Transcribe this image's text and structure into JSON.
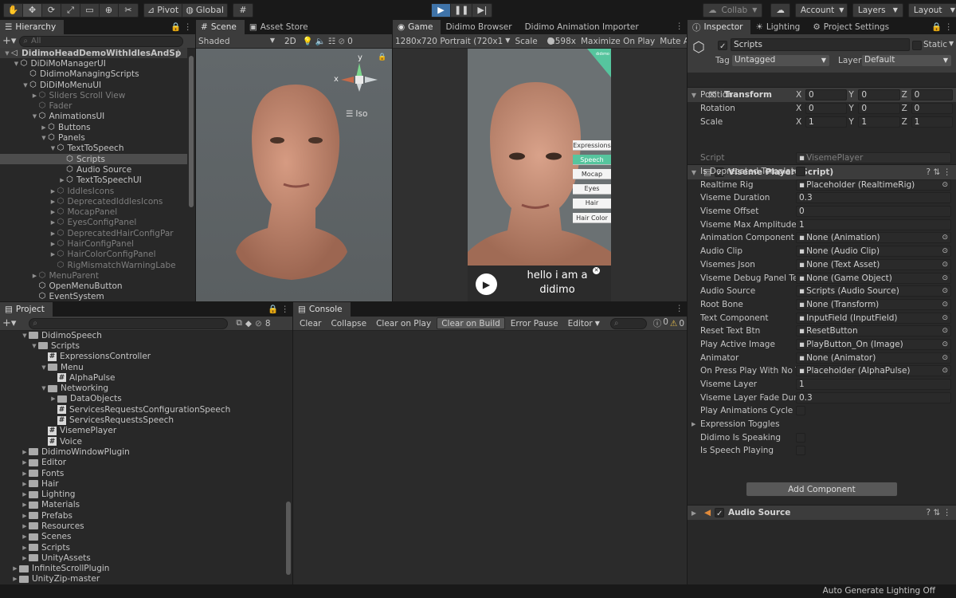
{
  "toolbar": {
    "tools": [
      "hand-icon",
      "move-icon",
      "rotate-icon",
      "scale-icon",
      "rect-icon",
      "transform-icon",
      "custom-tool-icon"
    ],
    "pivot": "Pivot",
    "global": "Global",
    "collab": "Collab",
    "account": "Account",
    "layers": "Layers",
    "layout": "Layout"
  },
  "hierarchy": {
    "tab": "Hierarchy",
    "search_placeholder": "All",
    "items": [
      {
        "label": "DidimoHeadDemoWithIdlesAndSp",
        "depth": 0,
        "state": "open",
        "icon": "scene",
        "dim": false,
        "sel": false,
        "bold": true
      },
      {
        "label": "DiDiMoManagerUI",
        "depth": 1,
        "state": "open",
        "icon": "cube",
        "dim": false,
        "sel": false
      },
      {
        "label": "DidimoManagingScripts",
        "depth": 2,
        "state": "none",
        "icon": "cube",
        "dim": false,
        "sel": false
      },
      {
        "label": "DiDiMoMenuUI",
        "depth": 2,
        "state": "open",
        "icon": "cube",
        "dim": false,
        "sel": false
      },
      {
        "label": "Sliders Scroll View",
        "depth": 3,
        "state": "closed",
        "icon": "cube",
        "dim": true,
        "sel": false
      },
      {
        "label": "Fader",
        "depth": 3,
        "state": "none",
        "icon": "cube",
        "dim": true,
        "sel": false
      },
      {
        "label": "AnimationsUI",
        "depth": 3,
        "state": "open",
        "icon": "cube",
        "dim": false,
        "sel": false
      },
      {
        "label": "Buttons",
        "depth": 4,
        "state": "closed",
        "icon": "cube",
        "dim": false,
        "sel": false
      },
      {
        "label": "Panels",
        "depth": 4,
        "state": "open",
        "icon": "cube",
        "dim": false,
        "sel": false
      },
      {
        "label": "TextToSpeech",
        "depth": 5,
        "state": "open",
        "icon": "cube",
        "dim": false,
        "sel": false
      },
      {
        "label": "Scripts",
        "depth": 6,
        "state": "none",
        "icon": "cube",
        "dim": false,
        "sel": true
      },
      {
        "label": "Audio Source",
        "depth": 6,
        "state": "none",
        "icon": "cube",
        "dim": false,
        "sel": false
      },
      {
        "label": "TextToSpeechUI",
        "depth": 6,
        "state": "closed",
        "icon": "cube",
        "dim": false,
        "sel": false
      },
      {
        "label": "IddlesIcons",
        "depth": 5,
        "state": "closed",
        "icon": "cube",
        "dim": true,
        "sel": false
      },
      {
        "label": "DeprecatedIddlesIcons",
        "depth": 5,
        "state": "closed",
        "icon": "cube",
        "dim": true,
        "sel": false
      },
      {
        "label": "MocapPanel",
        "depth": 5,
        "state": "closed",
        "icon": "cube",
        "dim": true,
        "sel": false
      },
      {
        "label": "EyesConfigPanel",
        "depth": 5,
        "state": "closed",
        "icon": "cube",
        "dim": true,
        "sel": false
      },
      {
        "label": "DeprecatedHairConfigPar",
        "depth": 5,
        "state": "closed",
        "icon": "cube",
        "dim": true,
        "sel": false
      },
      {
        "label": "HairConfigPanel",
        "depth": 5,
        "state": "closed",
        "icon": "cube",
        "dim": true,
        "sel": false
      },
      {
        "label": "HairColorConfigPanel",
        "depth": 5,
        "state": "closed",
        "icon": "cube",
        "dim": true,
        "sel": false
      },
      {
        "label": "RigMismatchWarningLabe",
        "depth": 5,
        "state": "none",
        "icon": "cube",
        "dim": true,
        "sel": false
      },
      {
        "label": "MenuParent",
        "depth": 3,
        "state": "closed",
        "icon": "cube",
        "dim": true,
        "sel": false
      },
      {
        "label": "OpenMenuButton",
        "depth": 3,
        "state": "none",
        "icon": "cube",
        "dim": false,
        "sel": false
      },
      {
        "label": "EventSystem",
        "depth": 3,
        "state": "none",
        "icon": "cube",
        "dim": false,
        "sel": false
      }
    ]
  },
  "scene": {
    "tabs": [
      "Scene",
      "Asset Store"
    ],
    "shading": "Shaded",
    "mode_2d": "2D",
    "gizmo_count": "0",
    "gizmo_y": "y",
    "gizmo_x": "x",
    "projection": "Iso"
  },
  "game": {
    "tabs": [
      "Game",
      "Didimo Browser",
      "Didimo Animation Importer"
    ],
    "resolution": "1280x720 Portrait (720x1",
    "scale_label": "Scale",
    "scale_value": "0.598x",
    "maximize": "Maximize On Play",
    "mute": "Mute Au",
    "side_buttons": [
      "Expressions",
      "Speech",
      "Mocap",
      "Eyes",
      "Hair",
      "Hair Color"
    ],
    "speech_text": "hello i am a didimo",
    "corner_logo": "dıdımo"
  },
  "project": {
    "tab": "Project",
    "hidden_count": "8",
    "items": [
      {
        "label": "DidimoSpeech",
        "depth": 1,
        "state": "open",
        "icon": "folder"
      },
      {
        "label": "Scripts",
        "depth": 2,
        "state": "open",
        "icon": "folder"
      },
      {
        "label": "ExpressionsController",
        "depth": 3,
        "state": "none",
        "icon": "hash"
      },
      {
        "label": "Menu",
        "depth": 3,
        "state": "open",
        "icon": "folder"
      },
      {
        "label": "AlphaPulse",
        "depth": 4,
        "state": "none",
        "icon": "hash"
      },
      {
        "label": "Networking",
        "depth": 3,
        "state": "open",
        "icon": "folder"
      },
      {
        "label": "DataObjects",
        "depth": 4,
        "state": "closed",
        "icon": "folder"
      },
      {
        "label": "ServicesRequestsConfigurationSpeech",
        "depth": 4,
        "state": "none",
        "icon": "hash"
      },
      {
        "label": "ServicesRequestsSpeech",
        "depth": 4,
        "state": "none",
        "icon": "hash"
      },
      {
        "label": "VisemePlayer",
        "depth": 3,
        "state": "none",
        "icon": "hash"
      },
      {
        "label": "Voice",
        "depth": 3,
        "state": "none",
        "icon": "hash"
      },
      {
        "label": "DidimoWindowPlugin",
        "depth": 1,
        "state": "closed",
        "icon": "folder"
      },
      {
        "label": "Editor",
        "depth": 1,
        "state": "closed",
        "icon": "folder"
      },
      {
        "label": "Fonts",
        "depth": 1,
        "state": "closed",
        "icon": "folder"
      },
      {
        "label": "Hair",
        "depth": 1,
        "state": "closed",
        "icon": "folder"
      },
      {
        "label": "Lighting",
        "depth": 1,
        "state": "closed",
        "icon": "folder"
      },
      {
        "label": "Materials",
        "depth": 1,
        "state": "closed",
        "icon": "folder"
      },
      {
        "label": "Prefabs",
        "depth": 1,
        "state": "closed",
        "icon": "folder"
      },
      {
        "label": "Resources",
        "depth": 1,
        "state": "closed",
        "icon": "folder"
      },
      {
        "label": "Scenes",
        "depth": 1,
        "state": "closed",
        "icon": "folder"
      },
      {
        "label": "Scripts",
        "depth": 1,
        "state": "closed",
        "icon": "folder"
      },
      {
        "label": "UnityAssets",
        "depth": 1,
        "state": "closed",
        "icon": "folder"
      },
      {
        "label": "InfiniteScrollPlugin",
        "depth": 0,
        "state": "closed",
        "icon": "folder"
      },
      {
        "label": "UnityZip-master",
        "depth": 0,
        "state": "closed",
        "icon": "folder"
      }
    ]
  },
  "console": {
    "tab": "Console",
    "clear": "Clear",
    "collapse": "Collapse",
    "clear_on_play": "Clear on Play",
    "clear_on_build": "Clear on Build",
    "error_pause": "Error Pause",
    "editor": "Editor",
    "info_count": "0",
    "warn_count": "0"
  },
  "inspector": {
    "tabs": [
      "Inspector",
      "Lighting",
      "Project Settings"
    ],
    "object_name": "Scripts",
    "static_label": "Static",
    "tag_label": "Tag",
    "tag_value": "Untagged",
    "layer_label": "Layer",
    "layer_value": "Default",
    "transform": {
      "title": "Transform",
      "rows": [
        {
          "label": "Position",
          "x": "0",
          "y": "0",
          "z": "0"
        },
        {
          "label": "Rotation",
          "x": "0",
          "y": "0",
          "z": "0"
        },
        {
          "label": "Scale",
          "x": "1",
          "y": "1",
          "z": "1"
        }
      ]
    },
    "viseme": {
      "title": "Viseme Player (Script)",
      "rows": [
        {
          "label": "Script",
          "value": "VisemePlayer",
          "type": "ref-dim"
        },
        {
          "label": "Is Deprecated Template",
          "value": "",
          "type": "check"
        },
        {
          "label": "Realtime Rig",
          "value": "Placeholder (RealtimeRig)",
          "type": "ref"
        },
        {
          "label": "Viseme Duration",
          "value": "0.3",
          "type": "field"
        },
        {
          "label": "Viseme Offset",
          "value": "0",
          "type": "field"
        },
        {
          "label": "Viseme Max Amplitude",
          "value": "1",
          "type": "field"
        },
        {
          "label": "Animation Component",
          "value": "None (Animation)",
          "type": "ref"
        },
        {
          "label": "Audio Clip",
          "value": "None (Audio Clip)",
          "type": "ref"
        },
        {
          "label": "Visemes Json",
          "value": "None (Text Asset)",
          "type": "ref"
        },
        {
          "label": "Viseme Debug Panel Tem",
          "value": "None (Game Object)",
          "type": "ref"
        },
        {
          "label": "Audio Source",
          "value": "Scripts (Audio Source)",
          "type": "ref"
        },
        {
          "label": "Root Bone",
          "value": "None (Transform)",
          "type": "ref"
        },
        {
          "label": "Text Component",
          "value": "InputField (InputField)",
          "type": "ref"
        },
        {
          "label": "Reset Text Btn",
          "value": "ResetButton",
          "type": "ref"
        },
        {
          "label": "Play Active Image",
          "value": "PlayButton_On (Image)",
          "type": "ref"
        },
        {
          "label": "Animator",
          "value": "None (Animator)",
          "type": "ref"
        },
        {
          "label": "On Press Play With No Te",
          "value": "Placeholder (AlphaPulse)",
          "type": "ref"
        },
        {
          "label": "Viseme Layer",
          "value": "1",
          "type": "field"
        },
        {
          "label": "Viseme Layer Fade Durat",
          "value": "0.3",
          "type": "field"
        },
        {
          "label": "Play Animations Cycle In",
          "value": "",
          "type": "check"
        },
        {
          "label": "Expression Toggles",
          "value": "",
          "type": "fold"
        },
        {
          "label": "Didimo Is Speaking",
          "value": "",
          "type": "check"
        },
        {
          "label": "Is Speech Playing",
          "value": "",
          "type": "check"
        }
      ]
    },
    "audio_source": "Audio Source",
    "add_component": "Add Component"
  },
  "statusbar": {
    "text": "Auto Generate Lighting Off"
  },
  "colors": {
    "accent_play": "#3f73a8",
    "speech_green": "#56c59e",
    "selection": "#4d4d4d"
  }
}
